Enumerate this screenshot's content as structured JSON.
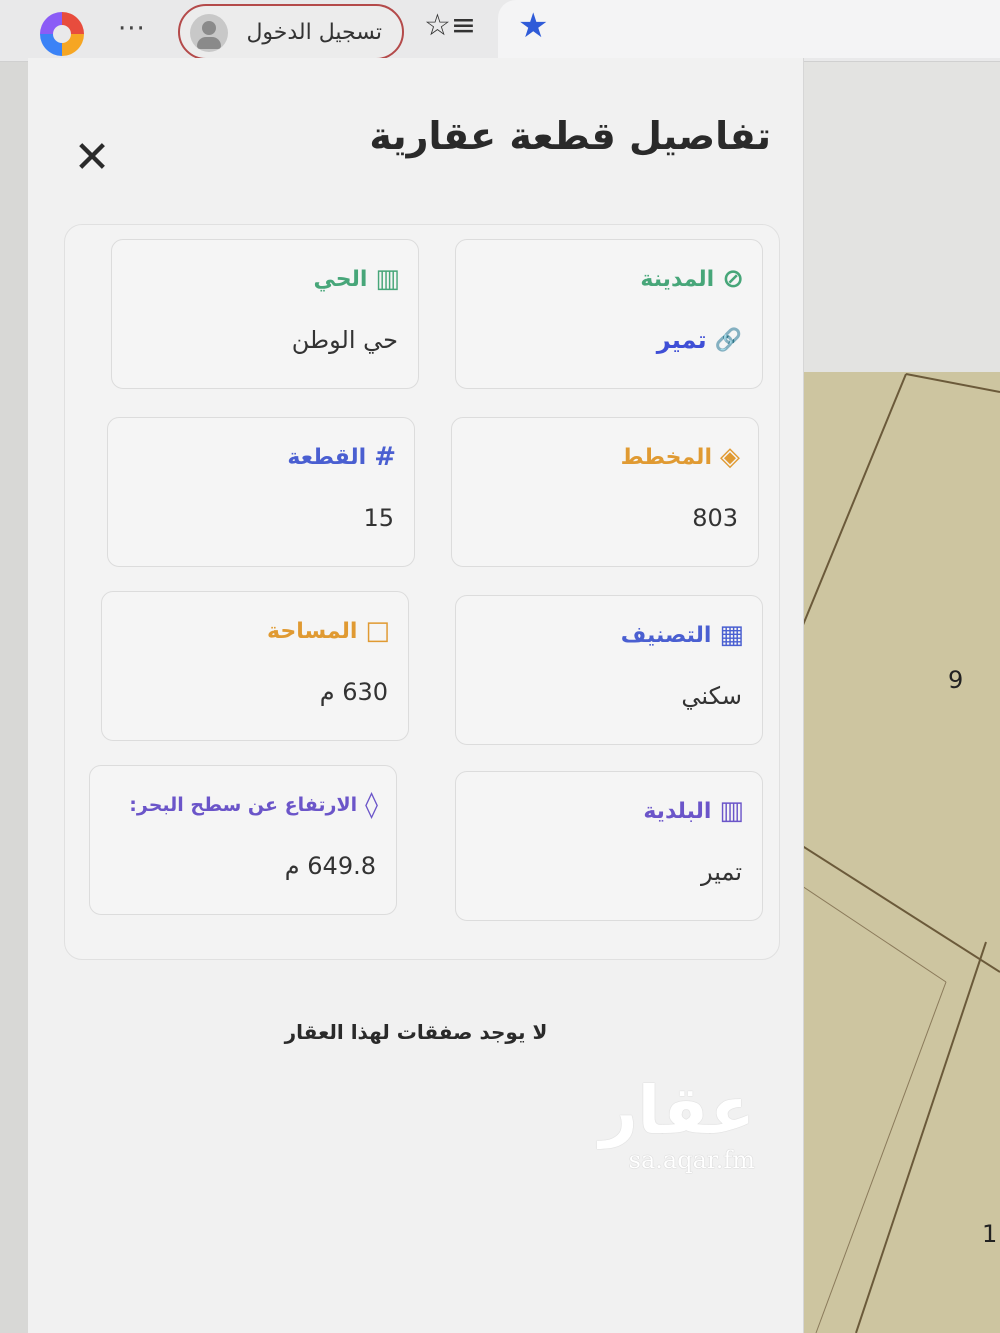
{
  "toolbar": {
    "more_label": "···",
    "login_label": "تسجيل الدخول",
    "favorites_icon": "☆≡",
    "star_icon": "★"
  },
  "panel": {
    "title": "تفاصيل قطعة عقارية",
    "close_label": "✕"
  },
  "fields": {
    "city": {
      "label": "المدينة",
      "icon": "⊘",
      "value": "تمير",
      "value_icon": "🔗",
      "color": "#47a679"
    },
    "district": {
      "label": "الحي",
      "icon": "▥",
      "value": "حي الوطن",
      "color": "#47a679"
    },
    "plan": {
      "label": "المخطط",
      "icon": "◈",
      "value": "803",
      "color": "#e09a32"
    },
    "plot": {
      "label": "القطعة",
      "icon": "#",
      "value": "15",
      "color": "#4a5fd1"
    },
    "classification": {
      "label": "التصنيف",
      "icon": "▦",
      "value": "سكني",
      "color": "#4a5fd1"
    },
    "area": {
      "label": "المساحة",
      "icon": "□",
      "value": "630 م",
      "color": "#e09a32"
    },
    "municipality": {
      "label": "البلدية",
      "icon": "▥",
      "value": "تمير",
      "color": "#6b55c9"
    },
    "elevation": {
      "label": "الارتفاع عن سطح البحر:",
      "icon": "◊",
      "value": "649.8 م",
      "color": "#6b55c9"
    }
  },
  "no_deals_text": "لا يوجد صفقات لهذا العقار",
  "watermark": {
    "brand": "عقار",
    "domain": "sa.aqar.fm"
  },
  "map": {
    "parcel_labels": [
      "9",
      "1"
    ]
  }
}
